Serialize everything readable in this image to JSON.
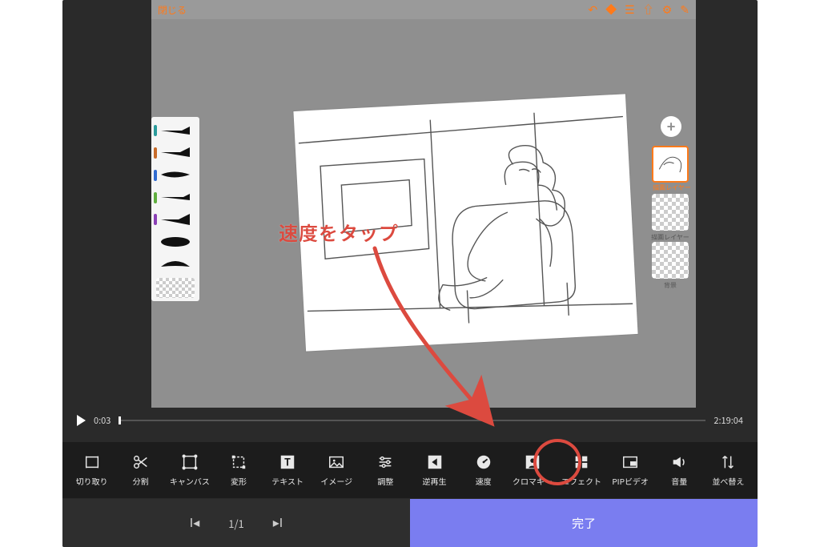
{
  "annotation": {
    "text": "速度をタップ"
  },
  "topbar": {
    "close": "閉じる",
    "icons": [
      "undo",
      "shape",
      "layers",
      "share",
      "settings",
      "brush"
    ]
  },
  "layers": {
    "add": "+",
    "item0_label": "描画レイヤー",
    "item1_label": "描画レイヤー",
    "item2_label": "背景"
  },
  "timeline": {
    "current": "0:03",
    "total": "2:19:04"
  },
  "tools": {
    "crop": "切り取り",
    "split": "分割",
    "canvas": "キャンバス",
    "transform": "変形",
    "text": "テキスト",
    "image": "イメージ",
    "adjust": "調整",
    "reverse": "逆再生",
    "speed": "速度",
    "chroma": "クロマキー",
    "effect": "エフェクト",
    "pip": "PIPビデオ",
    "volume": "音量",
    "reorder": "並べ替え"
  },
  "bottom": {
    "page": "1/1",
    "done": "完了"
  }
}
